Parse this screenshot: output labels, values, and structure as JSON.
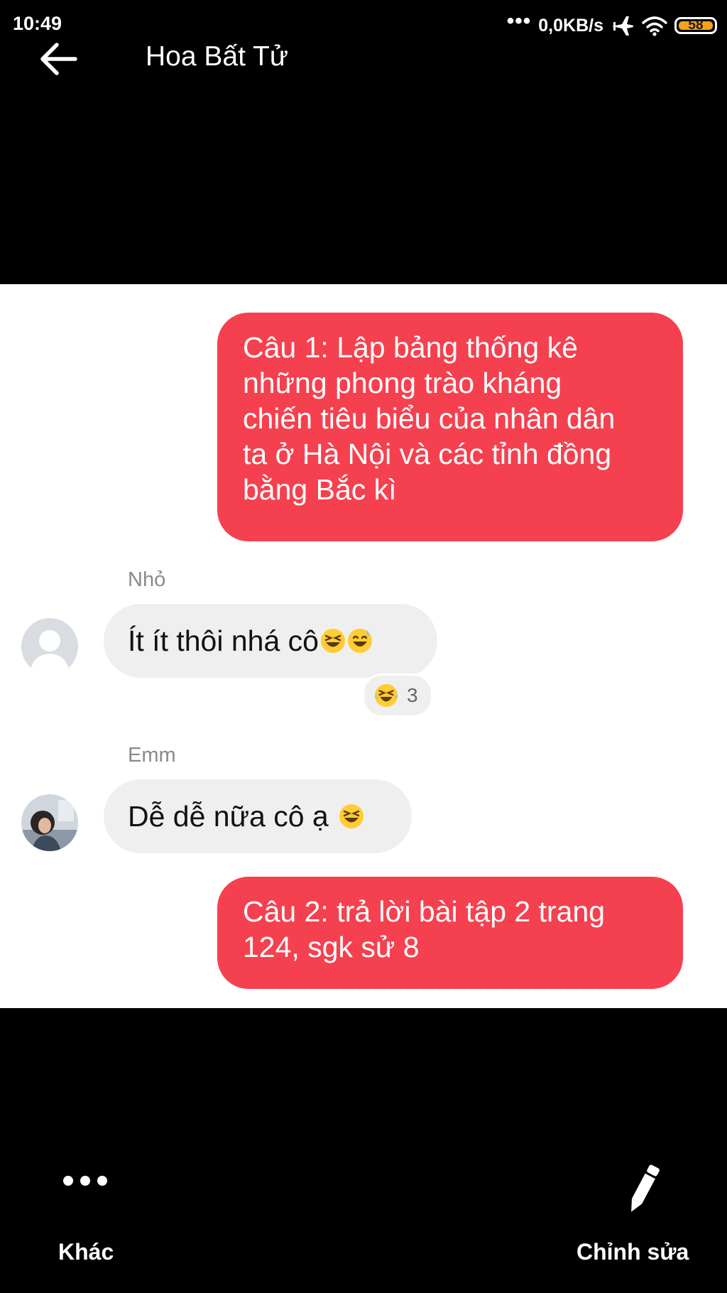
{
  "status_bar": {
    "time": "10:49",
    "dots": "•••",
    "network_speed": "0,0KB/s",
    "battery_level": "58",
    "icons": [
      "airplane-mode-icon",
      "wifi-icon",
      "battery-icon"
    ],
    "battery_color": "#f4a31c"
  },
  "header": {
    "back_icon": "arrow-left-icon",
    "title": "Hoa Bất Tử"
  },
  "chat": {
    "message_1": {
      "direction": "outgoing",
      "text": "Câu 1: Lập bảng thống kê những phong trào kháng chiến tiêu biểu của nhân dân ta ở Hà Nội và các tỉnh đồng bằng Bắc kì",
      "lines": [
        "Câu 1: Lập bảng thống kê",
        "những phong trào kháng",
        "chiến tiêu biểu của nhân dân",
        "ta ở Hà Nội và các tỉnh đồng",
        "bằng Bắc kì"
      ]
    },
    "message_2": {
      "direction": "incoming",
      "sender": "Nhỏ",
      "text": "Ít ít thôi nhá cô",
      "emojis": [
        "laughing-squint-emoji",
        "grinning-sweat-emoji"
      ],
      "reaction": {
        "emoji": "laughing-tears-emoji",
        "count": "3"
      }
    },
    "message_3": {
      "direction": "incoming",
      "sender": "Emm",
      "text": "Dễ dễ nữa cô ạ",
      "emojis": [
        "laughing-squint-emoji"
      ]
    },
    "message_4": {
      "direction": "outgoing",
      "text": "Câu 2: trả lời bài tập 2 trang 124, sgk sử 8",
      "lines": [
        "Câu 2: trả lời bài tập 2 trang",
        "124, sgk sử 8"
      ]
    },
    "outgoing_color": "#f5414f",
    "incoming_color": "#efefef"
  },
  "bottom_bar": {
    "more_icon": "more-dots-icon",
    "more_label": "Khác",
    "edit_icon": "pencil-icon",
    "edit_label": "Chỉnh sửa"
  }
}
